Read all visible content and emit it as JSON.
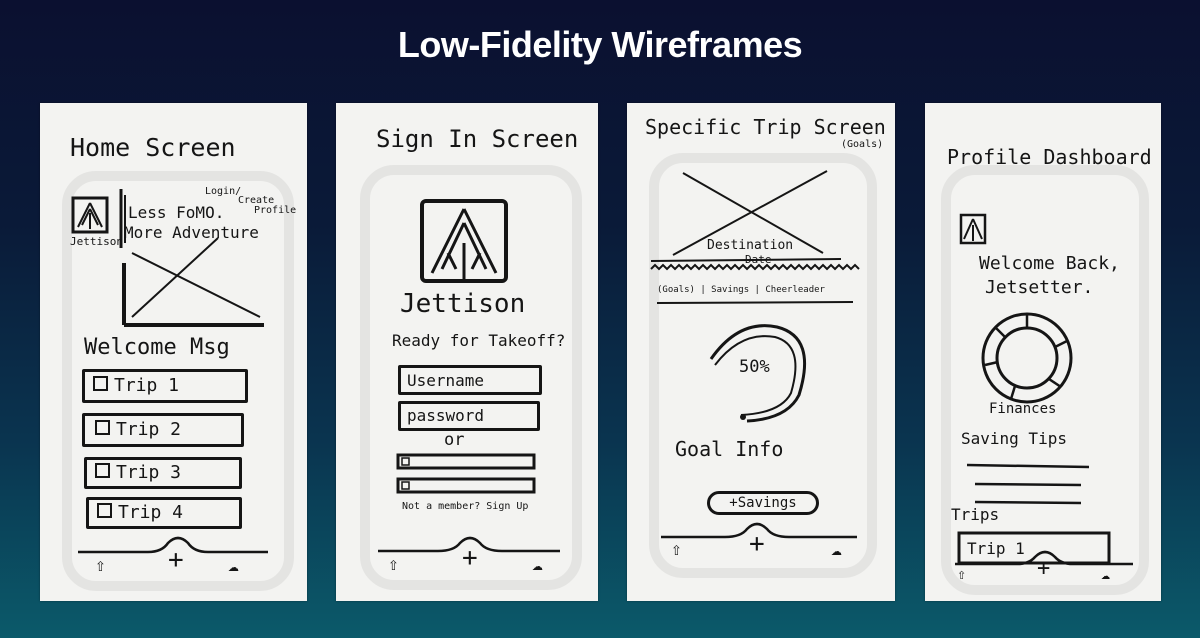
{
  "slide": {
    "title": "Low-Fidelity Wireframes"
  },
  "screens": {
    "home": {
      "heading": "Home Screen",
      "logo_caption": "Jettison",
      "tagline_1": "Less FoMO.",
      "tagline_2": "More Adventure",
      "note_1": "Login/",
      "note_2": "Create",
      "note_3": "Profile",
      "welcome": "Welcome Msg",
      "trips": [
        "Trip 1",
        "Trip 2",
        "Trip 3",
        "Trip 4"
      ],
      "nav_plus": "+"
    },
    "signin": {
      "heading": "Sign In Screen",
      "brand": "Jettison",
      "prompt": "Ready for Takeoff?",
      "username_label": "Username",
      "password_label": "password",
      "or_label": "or",
      "signup_text": "Not a member? Sign Up",
      "nav_plus": "+"
    },
    "trip": {
      "heading": "Specific Trip Screen",
      "heading_note": "(Goals)",
      "dest_label": "Destination",
      "date_label": "Date",
      "tabs_text": "(Goals) | Savings | Cheerleader",
      "progress_label": "50%",
      "progress_value": 0.5,
      "goal_info": "Goal Info",
      "savings_button": "+Savings",
      "nav_plus": "+"
    },
    "profile": {
      "heading": "Profile Dashboard",
      "welcome_1": "Welcome Back,",
      "welcome_2": "Jetsetter.",
      "finances": "Finances",
      "saving_tips": "Saving Tips",
      "trips_label": "Trips",
      "trip_item": "Trip 1",
      "nav_plus": "+"
    }
  }
}
